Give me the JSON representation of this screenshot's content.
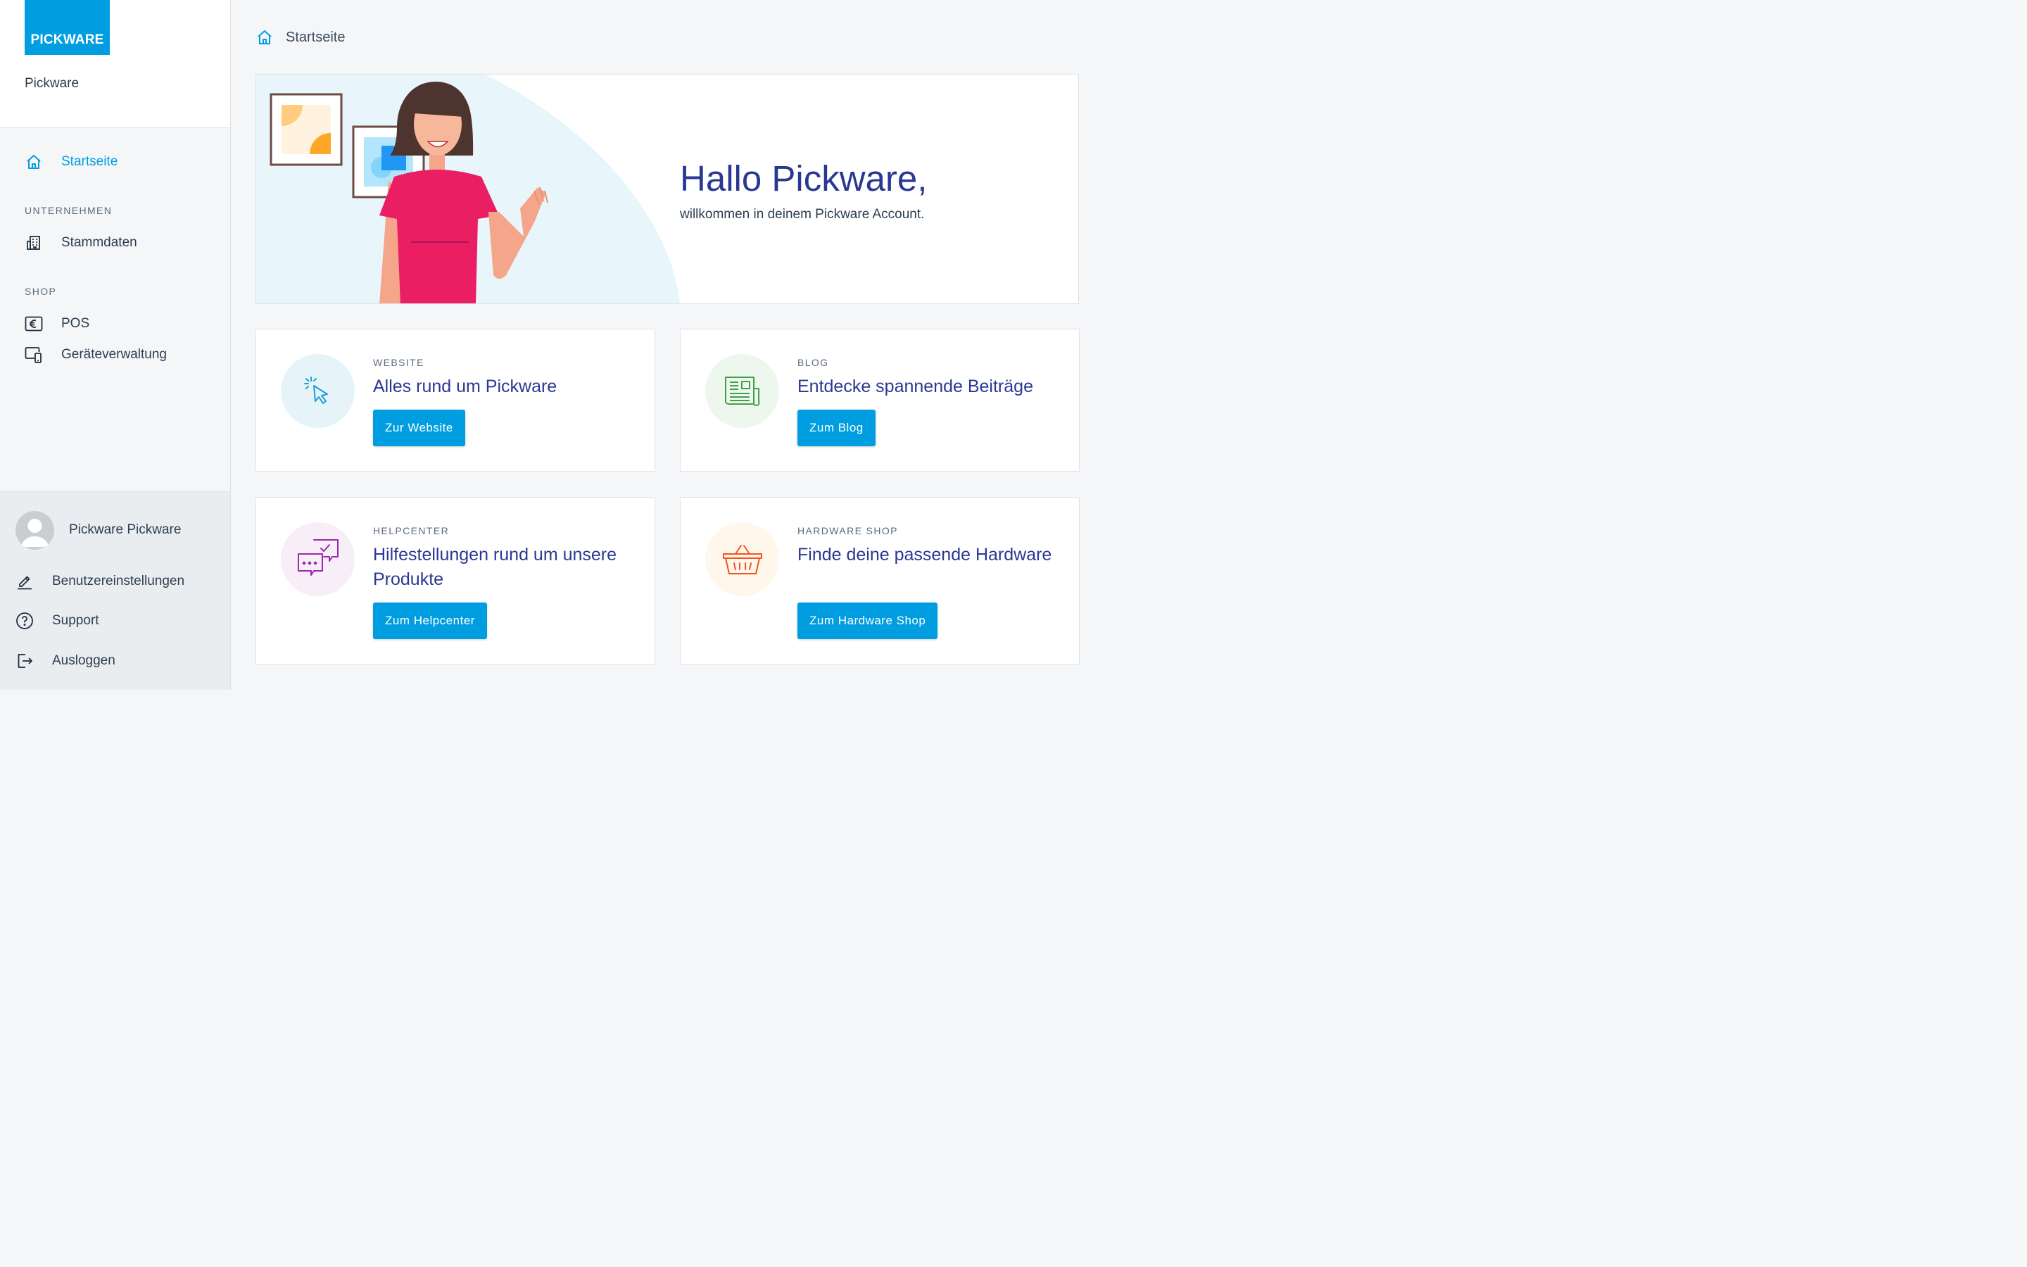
{
  "brand": {
    "logo_text": "PICKWARE",
    "name": "Pickware",
    "color": "#009ee0"
  },
  "sidebar": {
    "home_label": "Startseite",
    "sections": [
      {
        "title": "UNTERNEHMEN",
        "items": [
          {
            "label": "Stammdaten",
            "icon": "building-icon"
          }
        ]
      },
      {
        "title": "SHOP",
        "items": [
          {
            "label": "POS",
            "icon": "euro-icon"
          },
          {
            "label": "Geräteverwaltung",
            "icon": "devices-icon"
          }
        ]
      }
    ]
  },
  "user": {
    "name": "Pickware Pickware",
    "links": [
      {
        "label": "Benutzereinstellungen",
        "icon": "pencil-icon"
      },
      {
        "label": "Support",
        "icon": "help-icon"
      },
      {
        "label": "Ausloggen",
        "icon": "logout-icon"
      }
    ]
  },
  "breadcrumb": {
    "label": "Startseite"
  },
  "hero": {
    "title": "Hallo Pickware,",
    "subtitle": "willkommen in deinem Pickware Account."
  },
  "cards": [
    {
      "kicker": "WEBSITE",
      "title": "Alles rund um Pickware",
      "button": "Zur Website",
      "icon": "cursor-click-icon",
      "color": "#1a9fd6"
    },
    {
      "kicker": "BLOG",
      "title": "Entdecke spannende Beiträge",
      "button": "Zum Blog",
      "icon": "newspaper-icon",
      "color": "#43a047"
    },
    {
      "kicker": "HELPCENTER",
      "title": "Hilfestellungen rund um unsere Produkte",
      "button": "Zum Helpcenter",
      "icon": "chat-icon",
      "color": "#9c27b0"
    },
    {
      "kicker": "HARDWARE SHOP",
      "title": "Finde deine passende Hardware",
      "button": "Zum Hardware Shop",
      "icon": "basket-icon",
      "color": "#f4511e"
    }
  ]
}
